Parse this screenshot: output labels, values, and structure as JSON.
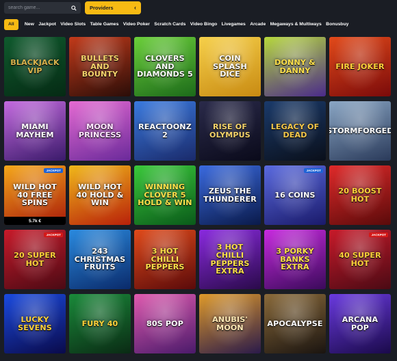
{
  "search": {
    "placeholder": "search game...",
    "icon": "search-icon"
  },
  "providers": {
    "label": "Providers",
    "icon": "chevron-left-icon"
  },
  "categories": [
    {
      "label": "All",
      "active": true
    },
    {
      "label": "New"
    },
    {
      "label": "Jackpot"
    },
    {
      "label": "Video Slots"
    },
    {
      "label": "Table Games"
    },
    {
      "label": "Video Poker"
    },
    {
      "label": "Scratch Cards"
    },
    {
      "label": "Video Bingo"
    },
    {
      "label": "Livegames"
    },
    {
      "label": "Arcade"
    },
    {
      "label": "Megaways & Multiways"
    },
    {
      "label": "Bonusbuy"
    }
  ],
  "colors": {
    "accent": "#f7ba13",
    "background": "#1a1d24",
    "jackpot_badge": "#1e63d6",
    "jackpot_badge_alt": "#d41818"
  },
  "games": [
    {
      "title": "Blackjack VIP",
      "bg1": "#0f5a2d",
      "bg2": "#052a14",
      "text": "#d9b24c"
    },
    {
      "title": "Bullets and Bounty",
      "bg1": "#c23a1a",
      "bg2": "#2a0d08",
      "text": "#f5d36b"
    },
    {
      "title": "Clovers and Diamonds 5",
      "bg1": "#6bcf3a",
      "bg2": "#1c6a1a",
      "text": "#ffffff"
    },
    {
      "title": "Coin Splash Dice",
      "bg1": "#f6d04a",
      "bg2": "#c88a12",
      "text": "#ffffff"
    },
    {
      "title": "Donny & Danny",
      "bg1": "#b6d83c",
      "bg2": "#4a2a8a",
      "text": "#ffe04a"
    },
    {
      "title": "Fire Joker",
      "bg1": "#e24a1a",
      "bg2": "#7a0a0a",
      "text": "#ffd23a"
    },
    {
      "title": "Miami Mayhem",
      "bg1": "#c46adf",
      "bg2": "#3a1a6a",
      "text": "#ffffff"
    },
    {
      "title": "Moon Princess",
      "bg1": "#e46ad2",
      "bg2": "#6a2a9a",
      "text": "#ffe8ff"
    },
    {
      "title": "Reactoonz 2",
      "bg1": "#3a7adf",
      "bg2": "#1a2a6a",
      "text": "#ffffff"
    },
    {
      "title": "Rise of Olympus",
      "bg1": "#2a2a4a",
      "bg2": "#0a0a1a",
      "text": "#f5d36b"
    },
    {
      "title": "Legacy of Dead",
      "bg1": "#1a3a6a",
      "bg2": "#0a0f1a",
      "text": "#f5c84a"
    },
    {
      "title": "Stormforged",
      "bg1": "#8aa6c4",
      "bg2": "#2a3a5a",
      "text": "#ffffff"
    },
    {
      "title": "Wild Hot 40 Free Spins",
      "bg1": "#f5a81a",
      "bg2": "#a81a0a",
      "text": "#ffffff",
      "badge": "Jackpot",
      "amount": "5.7k €"
    },
    {
      "title": "Wild Hot 40 Hold & Win",
      "bg1": "#f0b81a",
      "bg2": "#b8200a",
      "text": "#ffffff"
    },
    {
      "title": "Winning Clover 5 Hold & Win",
      "bg1": "#3ac83a",
      "bg2": "#0a5a1a",
      "text": "#ffe04a"
    },
    {
      "title": "Zeus the Thunderer",
      "bg1": "#3a6adf",
      "bg2": "#0a1a4a",
      "text": "#ffffff"
    },
    {
      "title": "16 Coins",
      "bg1": "#5a6adf",
      "bg2": "#1a1a6a",
      "text": "#ffffff",
      "badge": "Jackpot"
    },
    {
      "title": "20 Boost Hot",
      "bg1": "#e02a2a",
      "bg2": "#5a0a0a",
      "text": "#ffd23a"
    },
    {
      "title": "20 Super Hot",
      "bg1": "#c81a2a",
      "bg2": "#4a0a14",
      "text": "#ffd23a",
      "badge": "Jackpot",
      "badge_red": true
    },
    {
      "title": "243 Christmas Fruits",
      "bg1": "#2a8adf",
      "bg2": "#0a2a6a",
      "text": "#ffffff"
    },
    {
      "title": "3 Hot Chilli Peppers",
      "bg1": "#e04a1a",
      "bg2": "#5a0a0a",
      "text": "#ffe04a"
    },
    {
      "title": "3 Hot Chilli Peppers Extra",
      "bg1": "#8a2adf",
      "bg2": "#2a0a4a",
      "text": "#ffe04a"
    },
    {
      "title": "3 Porky Banks Extra",
      "bg1": "#c82adf",
      "bg2": "#3a0a5a",
      "text": "#ffe04a"
    },
    {
      "title": "40 Super Hot",
      "bg1": "#c81a2a",
      "bg2": "#4a0a14",
      "text": "#ffd23a",
      "badge": "Jackpot",
      "badge_red": true
    },
    {
      "title": "Lucky Sevens",
      "bg1": "#1a4adf",
      "bg2": "#0a0a4a",
      "text": "#ffd23a"
    },
    {
      "title": "Fury 40",
      "bg1": "#1a8a3a",
      "bg2": "#0a2a14",
      "text": "#ffd23a"
    },
    {
      "title": "80s Pop",
      "bg1": "#df5aaf",
      "bg2": "#4a1a6a",
      "text": "#ffffff"
    },
    {
      "title": "Anubis' Moon",
      "bg1": "#df9a2a",
      "bg2": "#2a1a4a",
      "text": "#ffe8b4"
    },
    {
      "title": "Apocalypse",
      "bg1": "#8a6a3a",
      "bg2": "#1a1410",
      "text": "#ffffff"
    },
    {
      "title": "Arcana Pop",
      "bg1": "#6a3adf",
      "bg2": "#1a0a4a",
      "text": "#ffffff"
    }
  ]
}
